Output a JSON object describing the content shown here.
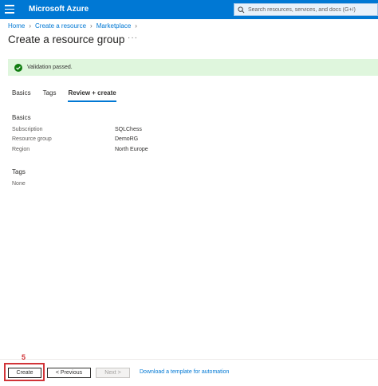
{
  "header": {
    "brand": "Microsoft Azure",
    "search_placeholder": "Search resources, services, and docs (G+/)"
  },
  "breadcrumb": [
    "Home",
    "Create a resource",
    "Marketplace"
  ],
  "page": {
    "title": "Create a resource group",
    "more": "···"
  },
  "validation": {
    "message": "Validation passed."
  },
  "tabs": [
    {
      "label": "Basics",
      "active": false
    },
    {
      "label": "Tags",
      "active": false
    },
    {
      "label": "Review + create",
      "active": true
    }
  ],
  "basics": {
    "title": "Basics",
    "rows": [
      {
        "label": "Subscription",
        "value": "SQLChess"
      },
      {
        "label": "Resource group",
        "value": "DemoRG"
      },
      {
        "label": "Region",
        "value": "North Europe"
      }
    ]
  },
  "tags": {
    "title": "Tags",
    "empty_text": "None"
  },
  "footer": {
    "step_number": "5",
    "create_label": "Create",
    "previous_label": "< Previous",
    "next_label": "Next >",
    "download_link": "Download a template for automation"
  },
  "colors": {
    "azure_blue": "#0078d4",
    "success_bg": "#dff6dd",
    "success_icon": "#107c10",
    "highlight_red": "#d13438"
  },
  "icons": [
    "hamburger-menu-icon",
    "search-icon",
    "chevron-right-icon",
    "more-icon",
    "check-circle-icon"
  ]
}
